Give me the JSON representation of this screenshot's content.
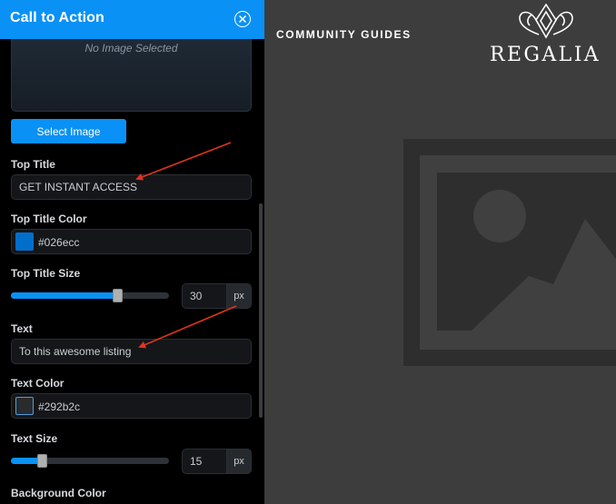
{
  "panel": {
    "title": "Call to Action",
    "image_placeholder": "No Image Selected",
    "select_image_label": "Select Image",
    "fields": {
      "top_title": {
        "label": "Top Title",
        "value": "GET INSTANT ACCESS"
      },
      "top_title_color": {
        "label": "Top Title Color",
        "value": "#026ecc"
      },
      "top_title_size": {
        "label": "Top Title Size",
        "value": "30",
        "unit": "px",
        "slider_fraction": 0.68
      },
      "text": {
        "label": "Text",
        "value": "To this awesome listing"
      },
      "text_color": {
        "label": "Text Color",
        "value": "#292b2c"
      },
      "text_size": {
        "label": "Text Size",
        "value": "15",
        "unit": "px",
        "slider_fraction": 0.2
      },
      "background_color": {
        "label": "Background Color"
      }
    }
  },
  "preview": {
    "tagline": "COMMUNITY GUIDES",
    "brand": "REGALIA"
  },
  "icons": {
    "close": "close-icon",
    "crown": "crown-logo-icon",
    "image": "image-placeholder-icon"
  },
  "colors": {
    "header_blue": "#0a91f5",
    "annotation_arrow": "#e1341e"
  }
}
